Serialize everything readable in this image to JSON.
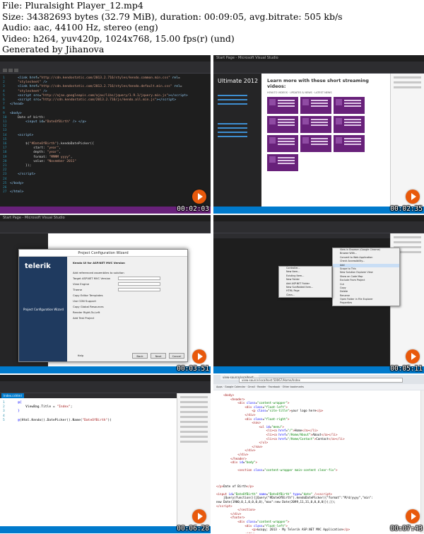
{
  "header": {
    "lines": [
      "File: Pluralsight Player_12.mp4",
      "Size: 34382693 bytes (32.79 MiB), duration: 00:09:05, avg.bitrate: 505 kb/s",
      "Audio: aac, 44100 Hz, stereo (eng)",
      "Video: h264, yuv420p, 1024x768, 15.00 fps(r) (und)",
      "Generated by Jihanova"
    ]
  },
  "thumbnails": [
    {
      "timestamp": "00:02:03"
    },
    {
      "timestamp": "00:02:35"
    },
    {
      "timestamp": "00:03:51"
    },
    {
      "timestamp": "00:05:11"
    },
    {
      "timestamp": "00:06:28"
    },
    {
      "timestamp": "00:07:43"
    }
  ],
  "thumb2": {
    "title": "Start Page - Microsoft Visual Studio",
    "product": "Ultimate 2012",
    "heading": "Learn more with these short streaming videos:",
    "tabs": "HOW-TO VIDEOS · UPDATES & NEWS · LATEST NEWS"
  },
  "thumb3": {
    "dialog_title": "Project Configuration Wizard",
    "logo": "telerik",
    "sub": "Project Configuration Wizard",
    "rows": [
      "Kendo UI for ASP.NET MVC Version",
      "Add referenced assemblies to solution",
      "Target ASP.NET MVC Version",
      "View Engine",
      "Theme",
      "Copy Editor Templates",
      "Use CDN Support",
      "Copy Global Resources",
      "Render Right-To-Left",
      "Add Test Project"
    ],
    "help_label": "Help",
    "back_label": "Back",
    "next_label": "Next",
    "cancel_label": "Cancel"
  },
  "thumb4": {
    "menu1": [
      "Controller...",
      "New Item...",
      "Existing Item...",
      "New Folder",
      "Add ASP.NET Folder",
      "New Scaffolded Item...",
      "HTML Page",
      "Class..."
    ],
    "menu2": [
      "View in Browser (Google Chrome)",
      "Browse With...",
      "Convert to Web Application",
      "Check Accessibility...",
      "Add",
      "Scope to This",
      "New Solution Explorer View",
      "Show on Code Map",
      "Exclude From Project",
      "Cut",
      "Copy",
      "Delete",
      "Rename",
      "Open Folder in File Explorer",
      "Properties"
    ]
  },
  "thumb6": {
    "tab": "view-source:localhost:...",
    "url": "view-source:localhost:50067/Home/Index",
    "bookmarks": "Apps · Google Calendar · Gmail · Reader · Facebook · Other bookmarks",
    "footer_text": "&copy; 2013 - My Telerik ASP.NET MVC Application"
  }
}
